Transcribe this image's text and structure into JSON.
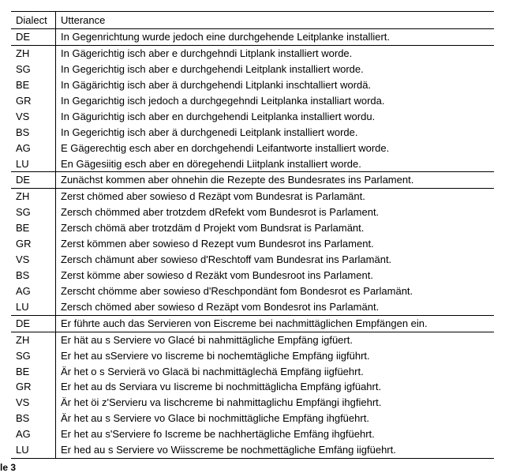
{
  "header": {
    "dialect_label": "Dialect",
    "utterance_label": "Utterance"
  },
  "caption": "le 3",
  "blocks": [
    {
      "de": {
        "dialect": "DE",
        "utterance": "In Gegenrichtung wurde jedoch eine durchgehende Leitplanke installiert."
      },
      "rows": [
        {
          "dialect": "ZH",
          "utterance": "In Gägerichtig isch aber e durchgehndi Litplank installiert worde."
        },
        {
          "dialect": "SG",
          "utterance": "In Gegerichtig isch aber e durchgehendi Leitplank installiert worde."
        },
        {
          "dialect": "BE",
          "utterance": "In Gägärichtig isch aber ä durchgehendi Litplanki inschtalliert wordä."
        },
        {
          "dialect": "GR",
          "utterance": "In Gegarichtig isch jedoch a durchgegehndi Leitplanka installiart worda."
        },
        {
          "dialect": "VS",
          "utterance": "In Gägurichtig isch aber en durchgehendi Leitplanka installiert wordu."
        },
        {
          "dialect": "BS",
          "utterance": "In Gegerichtig isch aber ä durchgenedi Leitplank installiert worde."
        },
        {
          "dialect": "AG",
          "utterance": "E Gägerechtig esch aber en dorchgehendi Leifantworte installiert worde."
        },
        {
          "dialect": "LU",
          "utterance": "En Gägesiitig esch aber en döregehendi Liitplank installiert worde."
        }
      ]
    },
    {
      "de": {
        "dialect": "DE",
        "utterance": "Zunächst kommen aber ohnehin die Rezepte des Bundesrates ins Parlament."
      },
      "rows": [
        {
          "dialect": "ZH",
          "utterance": "Zerst chömed aber sowieso d Rezäpt vom Bundesrat is Parlamänt."
        },
        {
          "dialect": "SG",
          "utterance": "Zersch chömmed aber trotzdem dRefekt vom Bundesrot is Parlament."
        },
        {
          "dialect": "BE",
          "utterance": "Zersch chömä aber trotzdäm d Projekt vom Bundsrat is Parlamänt."
        },
        {
          "dialect": "GR",
          "utterance": "Zerst kömmen aber sowieso d Rezept vum Bundesrot ins Parlament."
        },
        {
          "dialect": "VS",
          "utterance": "Zersch chämunt aber sowieso d'Reschtoff vam Bundesrat ins Parlamänt."
        },
        {
          "dialect": "BS",
          "utterance": "Zerst kömme aber sowieso d Rezäkt vom Bundesroot ins Parlament."
        },
        {
          "dialect": "AG",
          "utterance": "Zerscht chömme aber sowieso d'Reschpondänt fom Bondesrot es Parlamänt."
        },
        {
          "dialect": "LU",
          "utterance": "Zersch chömed aber sowieso d Rezäpt vom Bondesrot ins Parlamänt."
        }
      ]
    },
    {
      "de": {
        "dialect": "DE",
        "utterance": "Er führte auch das Servieren von Eiscreme bei nachmittäglichen Empfängen ein."
      },
      "rows": [
        {
          "dialect": "ZH",
          "utterance": "Er hät au s Serviere vo Glacé bi nahmittägliche Empfäng igfüert."
        },
        {
          "dialect": "SG",
          "utterance": "Er het au sServiere vo Iiscreme bi nochemtägliche Empfäng iigführt."
        },
        {
          "dialect": "BE",
          "utterance": "Är het o s Servierä vo Glacä bi nachmittäglechä Empfäng iigfüehrt."
        },
        {
          "dialect": "GR",
          "utterance": "Er het au ds Serviara vu Iiscreme bi nochmittäglicha Empfäng igfüahrt."
        },
        {
          "dialect": "VS",
          "utterance": "Är het öi z'Servieru va Iischcreme bi nahmittaglichu Empfängi ihgfiehrt."
        },
        {
          "dialect": "BS",
          "utterance": "Är het au s Serviere vo Glace bi nochmittägliche Empfäng ihgfüehrt."
        },
        {
          "dialect": "AG",
          "utterance": "Er het au s'Serviere fo Iscreme be nachhertägliche Emfäng ihgfüehrt."
        },
        {
          "dialect": "LU",
          "utterance": "Er hed au s Serviere vo Wiisscreme be nochmettägliche Emfäng iigfüehrt."
        }
      ]
    }
  ]
}
